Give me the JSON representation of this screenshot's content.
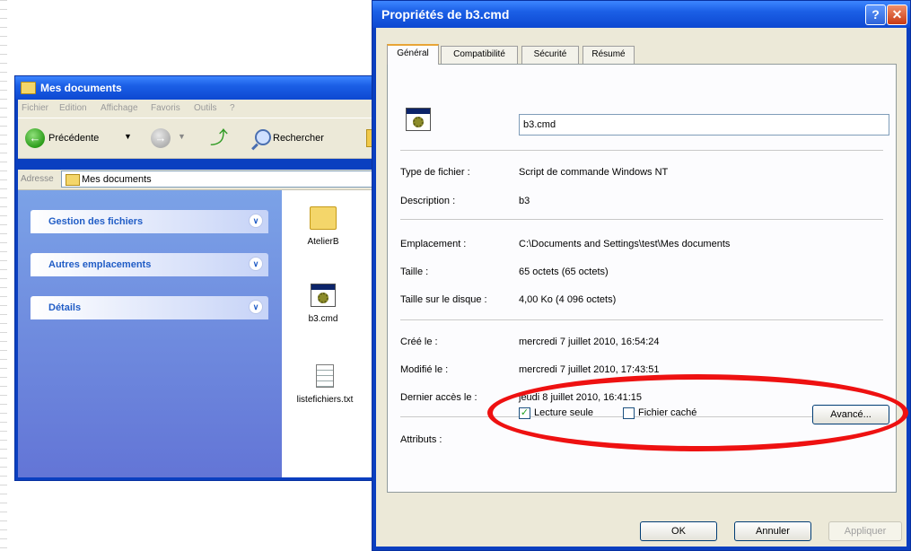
{
  "explorer": {
    "title": "Mes documents",
    "menu": [
      "Fichier",
      "Edition",
      "Affichage",
      "Favoris",
      "Outils",
      "?"
    ],
    "toolbar": {
      "back_label": "Précédente",
      "search_label": "Rechercher"
    },
    "address": {
      "label": "Adresse",
      "value": "Mes documents"
    },
    "task_groups": [
      "Gestion des fichiers",
      "Autres emplacements",
      "Détails"
    ],
    "files": [
      {
        "name": "AtelierB",
        "icon": "folder-icon"
      },
      {
        "name": "b3.cmd",
        "icon": "cmd-file-icon"
      },
      {
        "name": "listefichiers.txt",
        "icon": "text-file-icon"
      }
    ]
  },
  "dialog": {
    "title": "Propriétés de b3.cmd",
    "help_glyph": "?",
    "close_glyph": "✕",
    "tabs": [
      "Général",
      "Compatibilité",
      "Sécurité",
      "Résumé"
    ],
    "active_tab": "Général",
    "file_name": "b3.cmd",
    "rows": {
      "type": {
        "label": "Type de fichier :",
        "value": "Script de commande Windows NT"
      },
      "description": {
        "label": "Description :",
        "value": "b3"
      },
      "location": {
        "label": "Emplacement :",
        "value": "C:\\Documents and Settings\\test\\Mes documents"
      },
      "size": {
        "label": "Taille :",
        "value": "65 octets (65 octets)"
      },
      "size_on_disk": {
        "label": "Taille sur le disque :",
        "value": "4,00 Ko (4 096 octets)"
      },
      "created": {
        "label": "Créé le :",
        "value": "mercredi 7 juillet 2010, 16:54:24"
      },
      "modified": {
        "label": "Modifié le :",
        "value": "mercredi 7 juillet 2010, 17:43:51"
      },
      "accessed": {
        "label": "Dernier accès le :",
        "value": "jeudi 8 juillet 2010, 16:41:15"
      }
    },
    "attributes": {
      "label": "Attributs :",
      "read_only": {
        "label": "Lecture seule",
        "checked": true
      },
      "hidden": {
        "label": "Fichier caché",
        "checked": false
      },
      "advanced_button": "Avancé..."
    },
    "buttons": {
      "ok": "OK",
      "cancel": "Annuler",
      "apply": "Appliquer"
    }
  },
  "annotation": {
    "color": "#ee1111"
  }
}
